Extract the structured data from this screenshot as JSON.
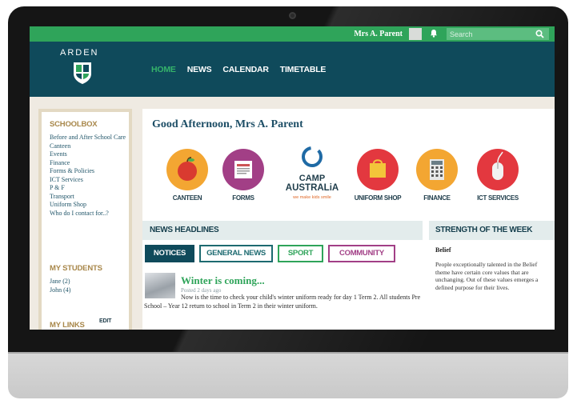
{
  "topbar": {
    "user_name": "Mrs A. Parent",
    "search_placeholder": "Search"
  },
  "header": {
    "logo_text": "ARDEN",
    "nav": [
      "HOME",
      "NEWS",
      "CALENDAR",
      "TIMETABLE"
    ],
    "active_nav": "HOME"
  },
  "sidebar": {
    "schoolbox_heading": "SCHOOLBOX",
    "schoolbox_links": [
      "Before and After School Care",
      "Canteen",
      "Events",
      "Finance",
      "Forms & Policies",
      "ICT Services",
      "P & F",
      "Transport",
      "Uniform Shop",
      "Who do I contact for..?"
    ],
    "students_heading": "MY STUDENTS",
    "students": [
      "Jane (2)",
      "John (4)"
    ],
    "links_heading": "MY LINKS",
    "links_edit": "EDIT"
  },
  "main": {
    "greeting": "Good Afternoon, Mrs A. Parent",
    "tiles": [
      {
        "label": "CANTEEN",
        "color": "#f3a632",
        "icon": "apple-icon"
      },
      {
        "label": "FORMS",
        "color": "#a23f86",
        "icon": "document-icon"
      },
      {
        "label": "CAMP AUSTRALIA",
        "color": "#ffffff",
        "icon": "camp-australia-logo",
        "tagline": "we make kids smile"
      },
      {
        "label": "UNIFORM SHOP",
        "color": "#e3383f",
        "icon": "shopping-bag-icon"
      },
      {
        "label": "FINANCE",
        "color": "#f3a632",
        "icon": "calculator-icon"
      },
      {
        "label": "ICT SERVICES",
        "color": "#e3383f",
        "icon": "mouse-icon"
      }
    ],
    "news_heading": "NEWS HEADLINES",
    "filters": [
      {
        "label": "NOTICES",
        "color": "#0f4a5b",
        "active": true
      },
      {
        "label": "GENERAL NEWS",
        "color": "#1d6a70",
        "active": false
      },
      {
        "label": "SPORT",
        "color": "#2fa45a",
        "active": false
      },
      {
        "label": "COMMUNITY",
        "color": "#a23f86",
        "active": false
      }
    ],
    "article": {
      "title": "Winter is coming...",
      "meta": "Posted 2 days ago",
      "body": "Now is the time to check your child's winter uniform ready for day 1 Term 2. All students Pre School – Year 12 return to school in Term 2 in their winter uniform."
    },
    "strength_heading": "STRENGTH OF THE WEEK",
    "strength_title": "Belief",
    "strength_text": "People exceptionally talented in the Belief theme have certain core values that are unchanging. Out of these values emerges a defined purpose for their lives."
  }
}
